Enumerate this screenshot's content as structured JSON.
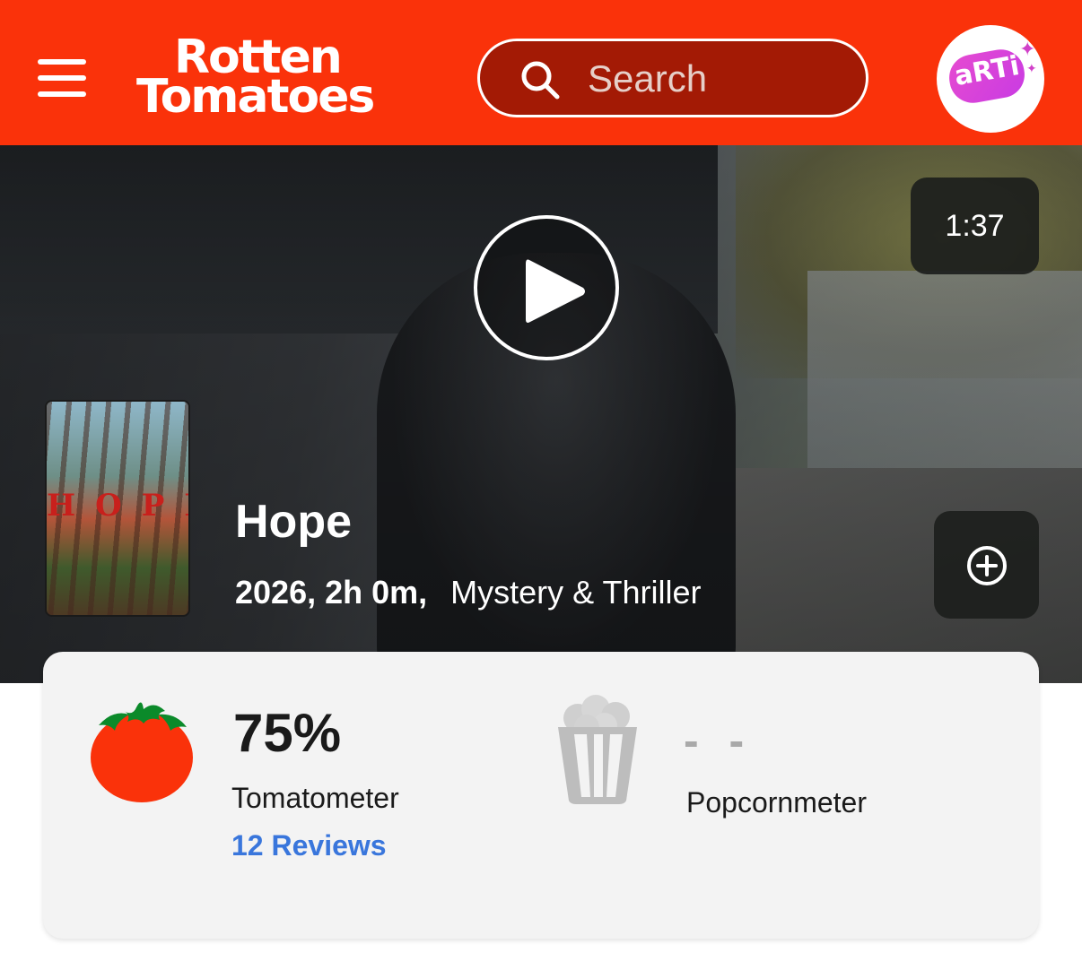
{
  "header": {
    "logo_line1": "Rotten",
    "logo_line2": "Tomatoes",
    "search_placeholder": "Search",
    "avatar_text": "aRTi",
    "brand_color": "#fa320a"
  },
  "hero": {
    "duration": "1:37",
    "poster_word": "HOPE",
    "title": "Hope",
    "year_runtime": "2026, 2h 0m,",
    "genre": "Mystery & Thriller"
  },
  "scores": {
    "tomatometer": {
      "value": "75%",
      "label": "Tomatometer",
      "reviews": "12 Reviews"
    },
    "popcornmeter": {
      "value": "- -",
      "label": "Popcornmeter"
    }
  },
  "icons": [
    "menu-icon",
    "search-icon",
    "play-icon",
    "add-circle-icon",
    "tomato-icon",
    "popcorn-icon"
  ]
}
